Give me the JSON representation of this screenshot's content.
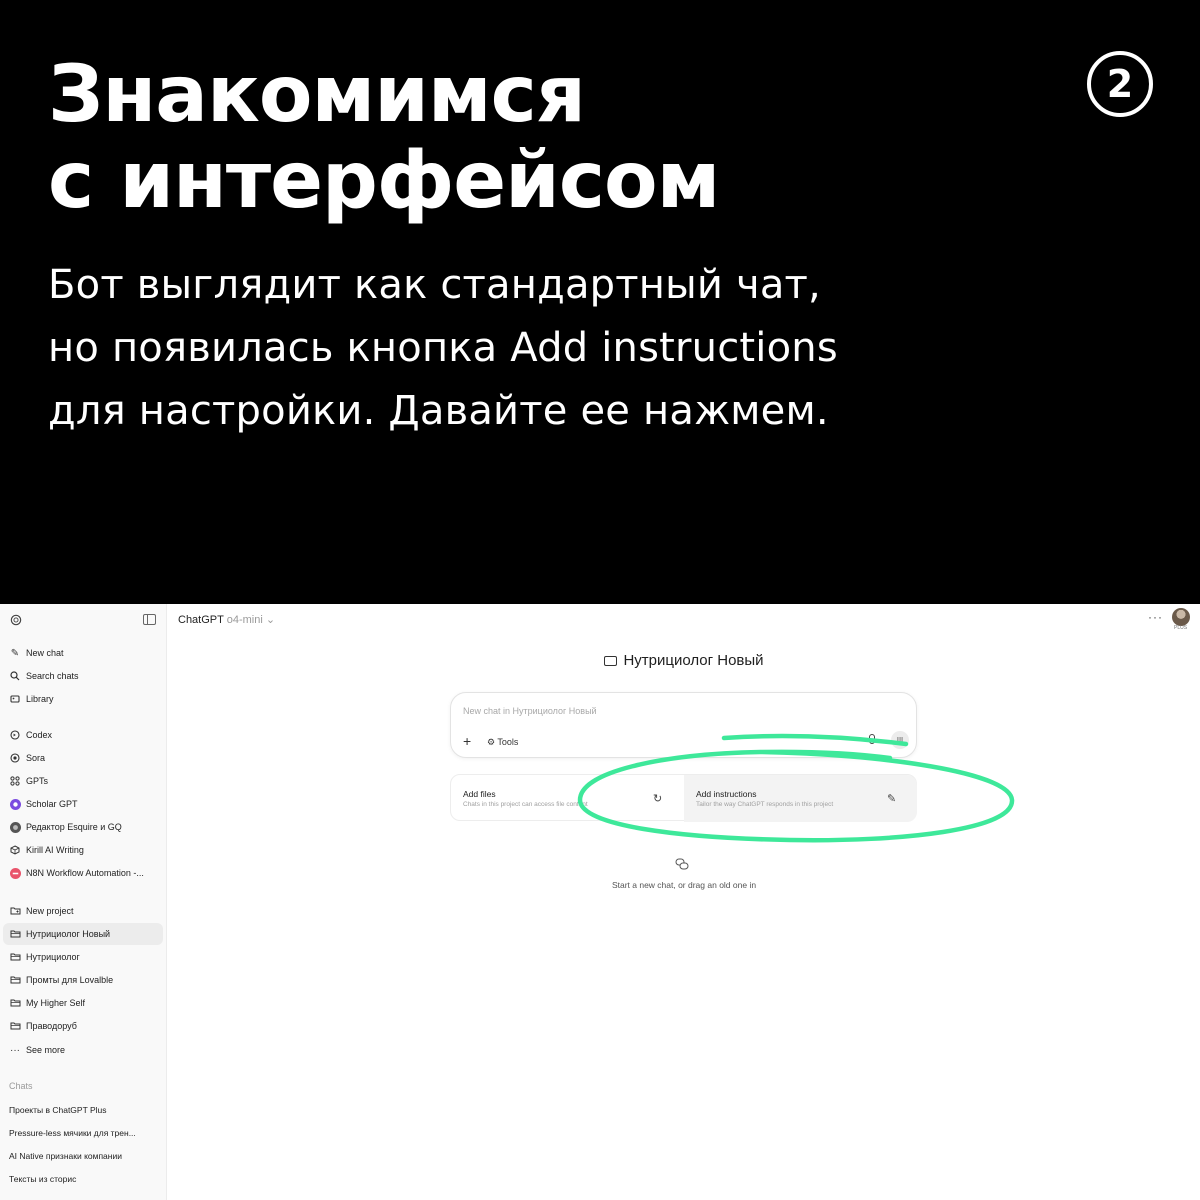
{
  "banner": {
    "headline": [
      "Знакомимся",
      "с интерфейсом"
    ],
    "step_badge": "2",
    "description": [
      "Бот выглядит как стандартный чат,",
      "но появилась кнопка Add instructions",
      "для настройки. Давайте ее нажмем."
    ]
  },
  "sidebar": {
    "top_items": [
      {
        "label": "New chat",
        "icon": "edit-icon"
      },
      {
        "label": "Search chats",
        "icon": "search-icon"
      },
      {
        "label": "Library",
        "icon": "library-icon"
      }
    ],
    "apps": [
      {
        "label": "Codex",
        "icon": "codex-icon"
      },
      {
        "label": "Sora",
        "icon": "sora-icon"
      },
      {
        "label": "GPTs",
        "icon": "grid-icon"
      },
      {
        "label": "Scholar GPT",
        "icon": "scholar-gpt-icon"
      },
      {
        "label": "Редактор Esquire и GQ",
        "icon": "gpt-avatar-icon"
      },
      {
        "label": "Kirill AI Writing",
        "icon": "cube-icon"
      },
      {
        "label": "N8N Workflow Automation -...",
        "icon": "n8n-icon"
      }
    ],
    "projects": [
      {
        "label": "New project",
        "icon": "new-folder-icon",
        "active": false
      },
      {
        "label": "Нутрициолог Новый",
        "icon": "folder-icon",
        "active": true
      },
      {
        "label": "Нутрициолог",
        "icon": "folder-icon",
        "active": false
      },
      {
        "label": "Промты для Lovalble",
        "icon": "folder-icon",
        "active": false
      },
      {
        "label": "My Higher Self",
        "icon": "folder-icon",
        "active": false
      },
      {
        "label": "Праводоруб",
        "icon": "folder-icon",
        "active": false
      },
      {
        "label": "See more",
        "icon": "more-icon",
        "active": false
      }
    ],
    "chats_heading": "Chats",
    "chats": [
      "Проекты в ChatGPT Plus",
      "Pressure-less мячики для трен...",
      "AI Native признаки компании",
      "Тексты из сторис"
    ]
  },
  "header": {
    "model_name": "ChatGPT",
    "model_variant": "o4-mini",
    "more_label": "···",
    "avatar_tag": "PLUS"
  },
  "project": {
    "title": "Нутрициолог Новый"
  },
  "composer": {
    "placeholder": "New chat in Нутрициолог Новый",
    "plus_label": "+",
    "tools_label": "Tools"
  },
  "cards": {
    "files": {
      "title": "Add files",
      "description": "Chats in this project can access file content"
    },
    "instructions": {
      "title": "Add instructions",
      "description": "Tailor the way ChatGPT responds in this project"
    }
  },
  "empty_state": {
    "text": "Start a new chat, or drag an old one in"
  },
  "colors": {
    "banner_bg": "#000000",
    "highlight": "#3ee89a",
    "active_item": "#ececec"
  }
}
